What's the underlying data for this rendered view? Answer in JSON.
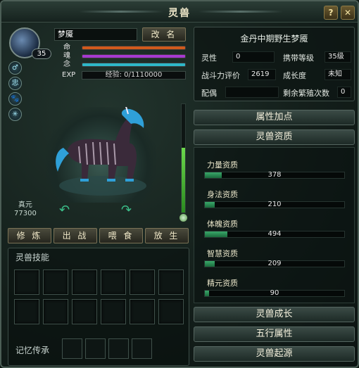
{
  "window": {
    "title": "灵兽",
    "help_label": "?",
    "close_label": "✕"
  },
  "pet": {
    "name": "梦魇",
    "level": "35",
    "rename_label": "改 名",
    "bars": [
      {
        "label": "命",
        "fill": 1.0,
        "color": "#d05a1c"
      },
      {
        "label": "魂",
        "fill": 1.0,
        "color": "#a63ad0"
      },
      {
        "label": "念",
        "fill": 1.0,
        "color": "#2eb8c8"
      }
    ],
    "exp_label": "EXP",
    "exp_text": "经验: 0/1110000",
    "exp_fraction": 0.0,
    "zhenyuan_label": "真元",
    "zhenyuan_value": "77300",
    "side_icons": [
      "♂",
      "忠",
      "🐾",
      "✳"
    ]
  },
  "actions": {
    "cultivate": "修 炼",
    "battle": "出 战",
    "feed": "喂 食",
    "release": "放 生"
  },
  "skills": {
    "title": "灵兽技能",
    "memory_title": "记忆传承"
  },
  "info": {
    "pet_title": "金丹中期野生梦魇",
    "rows": [
      {
        "l1": "灵性",
        "v1": "0",
        "l2": "携带等级",
        "v2": "35级"
      },
      {
        "l1": "战斗力评价",
        "v1": "2619",
        "l2": "成长度",
        "v2": "未知"
      },
      {
        "l1": "配偶",
        "v1": "",
        "l2": "剩余繁殖次数",
        "v2": "0"
      }
    ]
  },
  "sections": {
    "attr_bonus": "属性加点",
    "aptitude": "灵兽资质",
    "growth": "灵兽成长",
    "five_elements": "五行属性",
    "origin": "灵兽起源"
  },
  "aptitudes": [
    {
      "label": "力量资质",
      "value": "378",
      "fraction": 0.12
    },
    {
      "label": "身法资质",
      "value": "210",
      "fraction": 0.07
    },
    {
      "label": "体魄资质",
      "value": "494",
      "fraction": 0.16
    },
    {
      "label": "智慧资质",
      "value": "209",
      "fraction": 0.07
    },
    {
      "label": "精元资质",
      "value": "90",
      "fraction": 0.03
    }
  ],
  "colors": {
    "accent": "#3bbf8a",
    "gold": "#8c7a46"
  }
}
